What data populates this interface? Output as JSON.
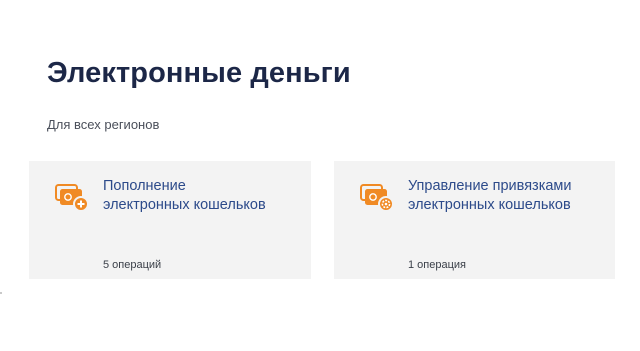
{
  "page": {
    "title": "Электронные деньги",
    "subtitle": "Для всех регионов"
  },
  "cards": [
    {
      "title_line1": "Пополнение",
      "title_line2": "электронных кошельков",
      "count": "5 операций",
      "icon": "wallet-add-icon"
    },
    {
      "title_line1": "Управление привязками",
      "title_line2": "электронных кошельков",
      "count": "1 операция",
      "icon": "wallet-settings-icon"
    }
  ],
  "colors": {
    "accent": "#f08a24",
    "title": "#1c2747",
    "link": "#2c4a8a",
    "card_bg": "#f3f3f3"
  }
}
